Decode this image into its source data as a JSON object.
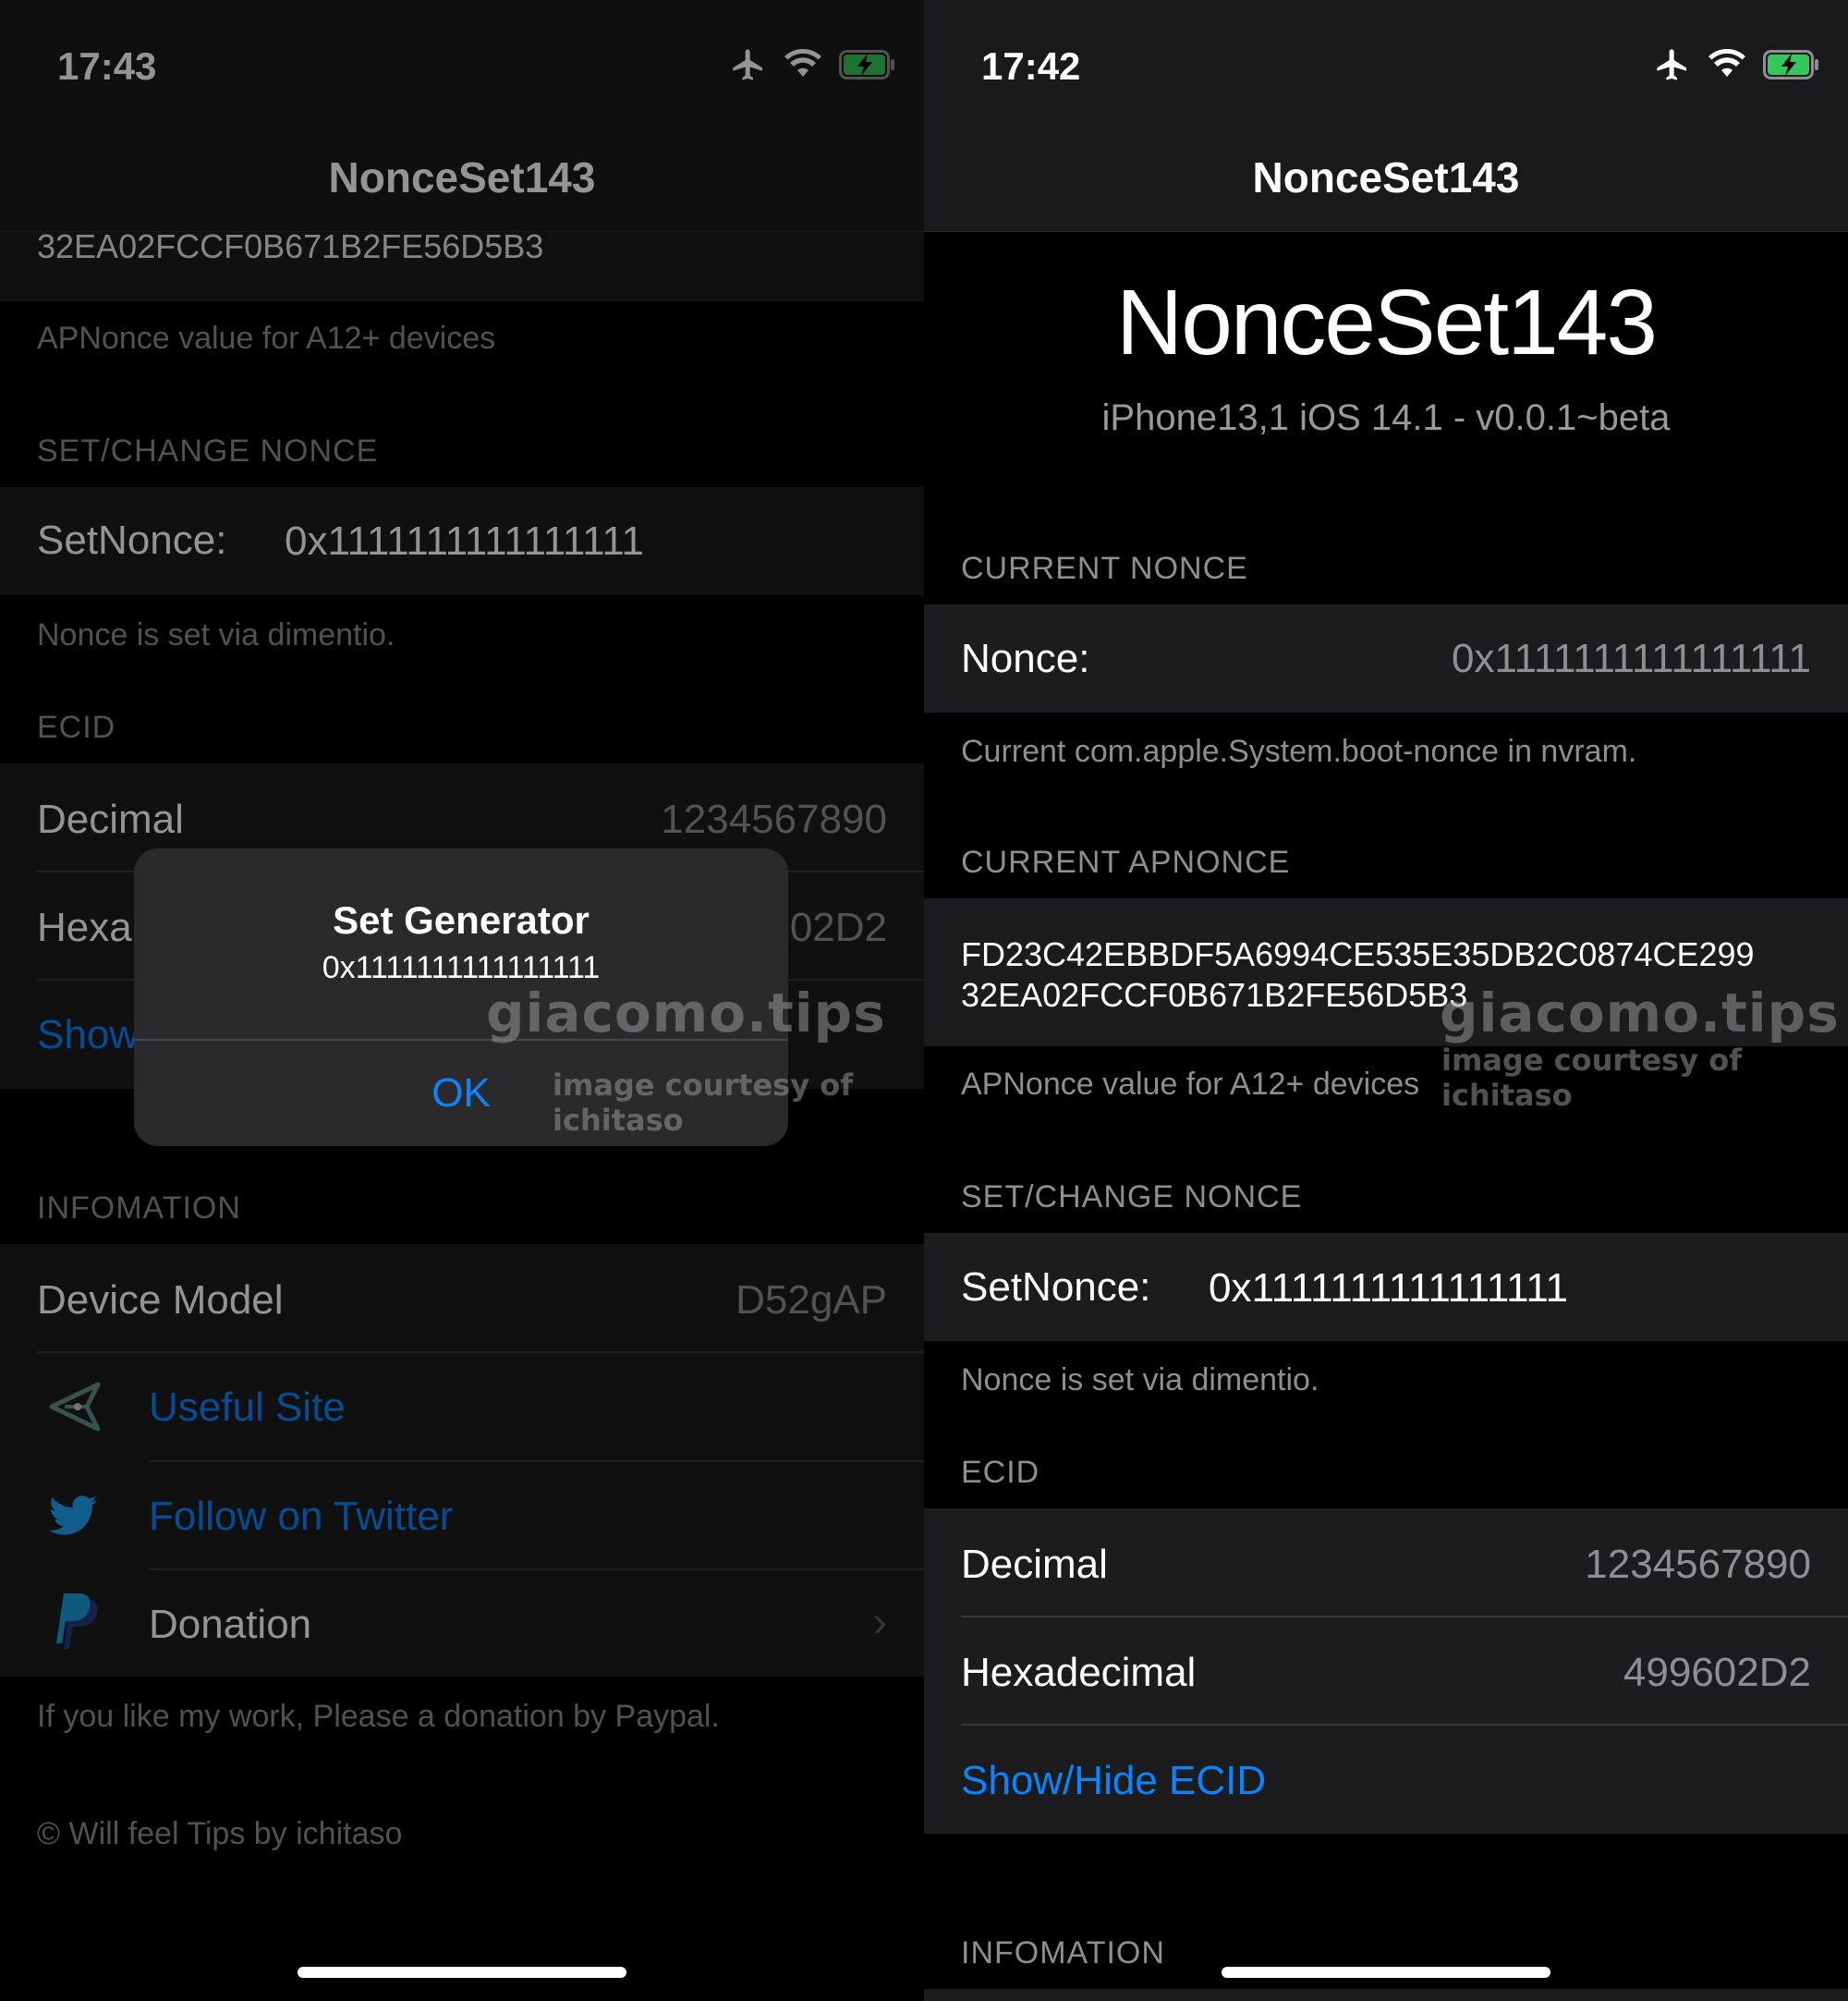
{
  "left_screen": {
    "status_time": "17:43",
    "nav_title": "NonceSet143",
    "apnonce_tail": "32EA02FCCF0B671B2FE56D5B3",
    "apnonce_footer": "APNonce value for A12+ devices",
    "set_change_header": "SET/CHANGE NONCE",
    "setnonce_label": "SetNonce:",
    "setnonce_value": "0x1111111111111111",
    "set_footer": "Nonce is set via dimentio.",
    "ecid_header": "ECID",
    "decimal_label": "Decimal",
    "decimal_value": "1234567890",
    "hex_label_partial": "Hexa",
    "hex_value_partial": "02D2",
    "showhide_partial": "Show",
    "info_header": "INFOMATION",
    "device_model_label": "Device Model",
    "device_model_value": "D52gAP",
    "useful_site": "Useful Site",
    "follow_twitter": "Follow on Twitter",
    "donation": "Donation",
    "donation_footer": "If you like my work, Please a donation by Paypal.",
    "copyright": "© Will feel Tips by ichitaso",
    "alert": {
      "title": "Set Generator",
      "message": "0x1111111111111111",
      "ok": "OK"
    },
    "icons": [
      "airplane-icon",
      "wifi-icon",
      "battery-charging-icon",
      "site-logo-icon",
      "twitter-icon",
      "paypal-icon",
      "chevron-right-icon"
    ]
  },
  "right_screen": {
    "status_time": "17:42",
    "nav_title": "NonceSet143",
    "big_title": "NonceSet143",
    "subtitle": "iPhone13,1 iOS 14.1 - v0.0.1~beta",
    "current_nonce_header": "CURRENT NONCE",
    "nonce_label": "Nonce:",
    "nonce_value": "0x1111111111111111",
    "nonce_footer": "Current com.apple.System.boot-nonce in nvram.",
    "current_apnonce_header": "CURRENT APNONCE",
    "apnonce_line1": "FD23C42EBBDF5A6994CE535E35DB2C0874CE299",
    "apnonce_line2": "32EA02FCCF0B671B2FE56D5B3",
    "apnonce_footer": "APNonce value for A12+ devices",
    "set_change_header": "SET/CHANGE NONCE",
    "setnonce_label": "SetNonce:",
    "setnonce_value": "0x1111111111111111",
    "set_footer": "Nonce is set via dimentio.",
    "ecid_header": "ECID",
    "decimal_label": "Decimal",
    "decimal_value": "1234567890",
    "hex_label": "Hexadecimal",
    "hex_value": "499602D2",
    "showhide": "Show/Hide ECID",
    "info_header": "INFOMATION"
  },
  "watermark": {
    "main": "giacomo.tips",
    "sub": "image courtesy of ichitaso"
  },
  "colors": {
    "background": "#000000",
    "cell": "#1c1c1e",
    "accent_blue": "#0a84ff",
    "secondary_text": "#8e8e93",
    "battery_green": "#34c759"
  }
}
